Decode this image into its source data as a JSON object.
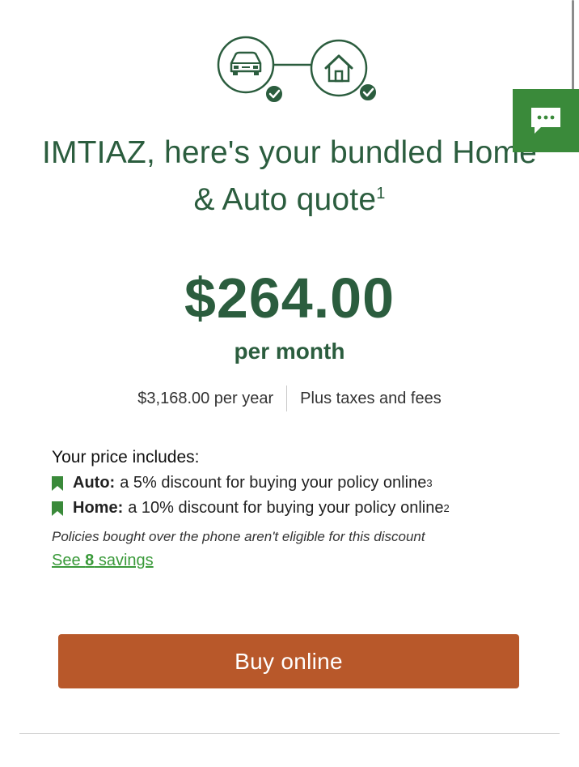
{
  "icons": {
    "car": "car-icon",
    "house": "house-icon",
    "check": "check-icon",
    "chat": "chat-bubble-icon"
  },
  "colors": {
    "brand_green": "#2b5d3e",
    "chat_green": "#3a8a3a",
    "link_green": "#3a9a3a",
    "buy_orange": "#b8582a"
  },
  "headline": {
    "line1": "IMTIAZ, here's your bundled Home",
    "line2": "& Auto quote",
    "footnote": "1"
  },
  "price": {
    "amount": "$264.00",
    "period": "per month",
    "yearly": "$3,168.00 per year",
    "taxes": "Plus taxes and fees"
  },
  "includes": {
    "title": "Your price includes:",
    "items": [
      {
        "label": "Auto:",
        "text": "a 5% discount for buying your policy online",
        "footnote": "3"
      },
      {
        "label": "Home:",
        "text": "a 10% discount for buying your policy online",
        "footnote": "2"
      }
    ],
    "note": "Policies bought over the phone aren't eligible for this discount",
    "link_prefix": "See ",
    "link_count": "8",
    "link_suffix": " savings"
  },
  "actions": {
    "buy": "Buy online"
  }
}
